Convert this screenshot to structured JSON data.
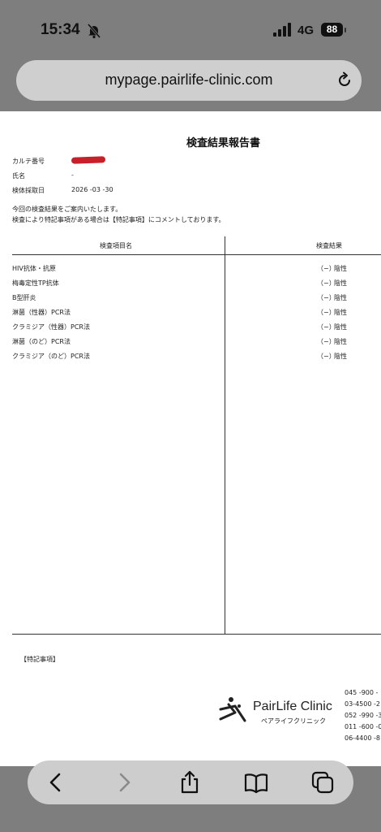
{
  "status_bar": {
    "time": "15:34",
    "network": "4G",
    "battery": "88"
  },
  "browser": {
    "url": "mypage.pairlife-clinic.com"
  },
  "report": {
    "title": "検査結果報告書",
    "fields": [
      {
        "label": "カルテ番号",
        "value": ""
      },
      {
        "label": "氏名",
        "value": "-"
      },
      {
        "label": "検体採取日",
        "value": "2026 -03 -30"
      }
    ],
    "notice": [
      "今回の検査結果をご案内いたします。",
      "検査により特記事項がある場合は【特記事項】にコメントしております。"
    ],
    "columns": {
      "name": "検査項目名",
      "result": "検査結果"
    },
    "rows": [
      {
        "name": "HIV抗体・抗原",
        "mark": "（−）",
        "result": "陰性"
      },
      {
        "name": "梅毒定性TP抗体",
        "mark": "（−）",
        "result": "陰性"
      },
      {
        "name": "B型肝炎",
        "mark": "（−）",
        "result": "陰性"
      },
      {
        "name": "淋菌（性器）PCR法",
        "mark": "（−）",
        "result": "陰性"
      },
      {
        "name": "クラミジア（性器）PCR法",
        "mark": "（−）",
        "result": "陰性"
      },
      {
        "name": "淋菌（のど）PCR法",
        "mark": "（−）",
        "result": "陰性"
      },
      {
        "name": "クラミジア（のど）PCR法",
        "mark": "（−）",
        "result": "陰性"
      }
    ],
    "remarks_label": "【特記事項】",
    "clinic": {
      "name": "PairLife Clinic",
      "kana": "ペアライフクリニック",
      "phones": [
        "045 -900 -",
        "03-4500 -2",
        "052 -990 -3",
        "011 -600 -0",
        "06-4400 -8"
      ]
    }
  },
  "icons": {
    "bell_muted": "bell-slash-icon",
    "signal": "signal-bars-icon",
    "reload": "reload-icon",
    "back": "chevron-left-icon",
    "forward": "chevron-right-icon",
    "share": "share-icon",
    "bookmarks": "book-icon",
    "tabs": "tabs-icon"
  }
}
